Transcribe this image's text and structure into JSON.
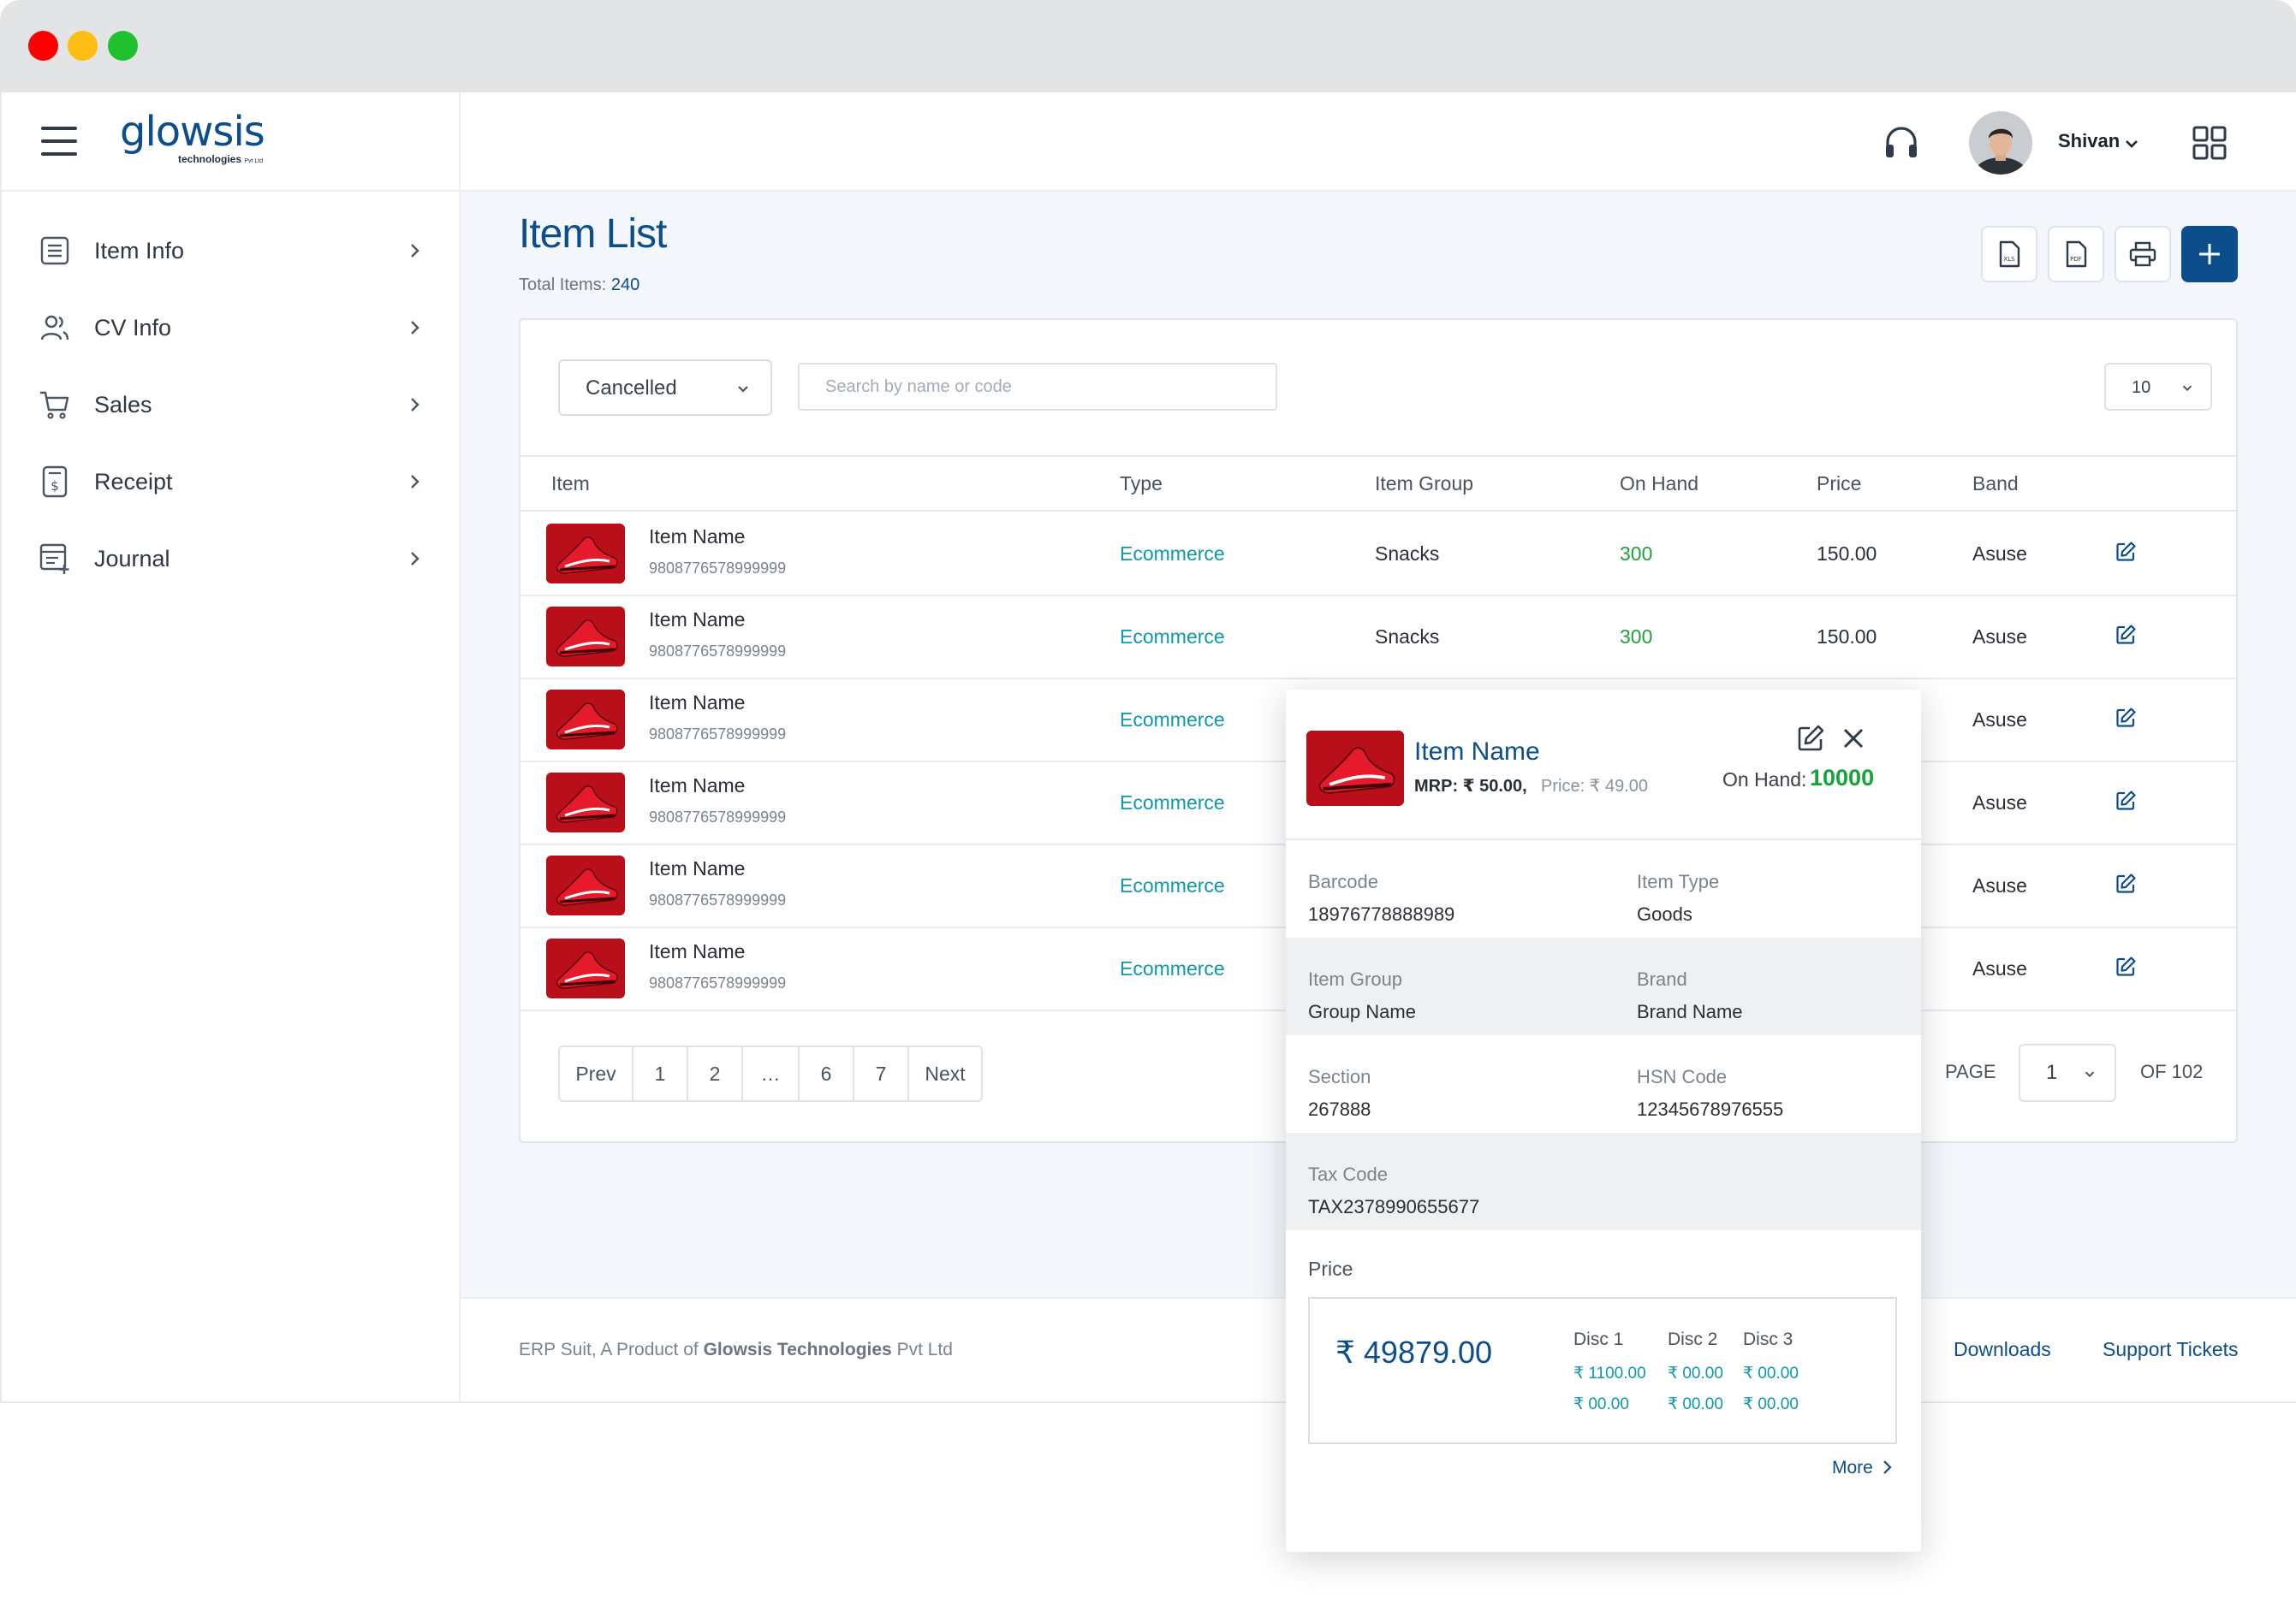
{
  "brand": {
    "logo_main": "glowsis",
    "logo_sub": "technologies",
    "logo_sub_small": "Pvt Ltd"
  },
  "colors": {
    "primary": "#0c4d8c",
    "teal": "#0e97ad",
    "green": "#21a03b",
    "content_bg": "#f3f6fa"
  },
  "sidebar": {
    "items": [
      {
        "label": "Item Info",
        "icon": "list-icon"
      },
      {
        "label": "CV Info",
        "icon": "users-icon"
      },
      {
        "label": "Sales",
        "icon": "cart-icon"
      },
      {
        "label": "Receipt",
        "icon": "receipt-icon"
      },
      {
        "label": "Journal",
        "icon": "journal-icon"
      }
    ]
  },
  "topbar": {
    "user_name": "Shivan"
  },
  "page": {
    "title": "Item List",
    "total_label": "Total Items:",
    "total_value": "240"
  },
  "filters": {
    "status_value": "Cancelled",
    "search_placeholder": "Search by name or code",
    "per_page": "10"
  },
  "table": {
    "headers": {
      "item": "Item",
      "type": "Type",
      "group": "Item Group",
      "onhand": "On Hand",
      "price": "Price",
      "band": "Band"
    },
    "rows": [
      {
        "name": "Item Name",
        "code": "9808776578999999",
        "type": "Ecommerce",
        "group": "Snacks",
        "onhand": "300",
        "price": "150.00",
        "band": "Asuse"
      },
      {
        "name": "Item Name",
        "code": "9808776578999999",
        "type": "Ecommerce",
        "group": "Snacks",
        "onhand": "300",
        "price": "150.00",
        "band": "Asuse"
      },
      {
        "name": "Item Name",
        "code": "9808776578999999",
        "type": "Ecommerce",
        "group": "",
        "onhand": "",
        "price": "",
        "band": "Asuse"
      },
      {
        "name": "Item Name",
        "code": "9808776578999999",
        "type": "Ecommerce",
        "group": "",
        "onhand": "",
        "price": "",
        "band": "Asuse"
      },
      {
        "name": "Item Name",
        "code": "9808776578999999",
        "type": "Ecommerce",
        "group": "",
        "onhand": "",
        "price": "",
        "band": "Asuse"
      },
      {
        "name": "Item Name",
        "code": "9808776578999999",
        "type": "Ecommerce",
        "group": "",
        "onhand": "",
        "price": "",
        "band": "Asuse"
      }
    ]
  },
  "pagination": {
    "prev": "Prev",
    "next": "Next",
    "pages": [
      "1",
      "2",
      "…",
      "6",
      "7"
    ],
    "page_label": "PAGE",
    "current_page": "1",
    "of_label": "OF 102"
  },
  "footer": {
    "text_prefix": "ERP Suit, A Product of ",
    "company": "Glowsis Technologies",
    "text_suffix": " Pvt Ltd",
    "downloads": "Downloads",
    "support": "Support Tickets"
  },
  "popup": {
    "name": "Item Name",
    "mrp": "MRP: ₹ 50.00,",
    "price": "Price: ₹ 49.00",
    "onhand_label": "On Hand:",
    "onhand_value": "10000",
    "fields": [
      {
        "label": "Barcode",
        "value": "18976778888989"
      },
      {
        "label": "Item Type",
        "value": "Goods"
      },
      {
        "label": "Item Group",
        "value": "Group Name"
      },
      {
        "label": "Brand",
        "value": "Brand Name"
      },
      {
        "label": "Section",
        "value": "267888"
      },
      {
        "label": "HSN Code",
        "value": "12345678976555"
      },
      {
        "label": "Tax Code",
        "value": "TAX2378990655677"
      }
    ],
    "price_label": "Price",
    "price_total": "₹ 49879.00",
    "discounts": [
      {
        "label": "Disc 1",
        "values": [
          "₹ 1100.00",
          "₹ 00.00"
        ]
      },
      {
        "label": "Disc 2",
        "values": [
          "₹ 00.00",
          "₹ 00.00"
        ]
      },
      {
        "label": "Disc 3",
        "values": [
          "₹ 00.00",
          "₹ 00.00"
        ]
      }
    ],
    "more": "More"
  }
}
